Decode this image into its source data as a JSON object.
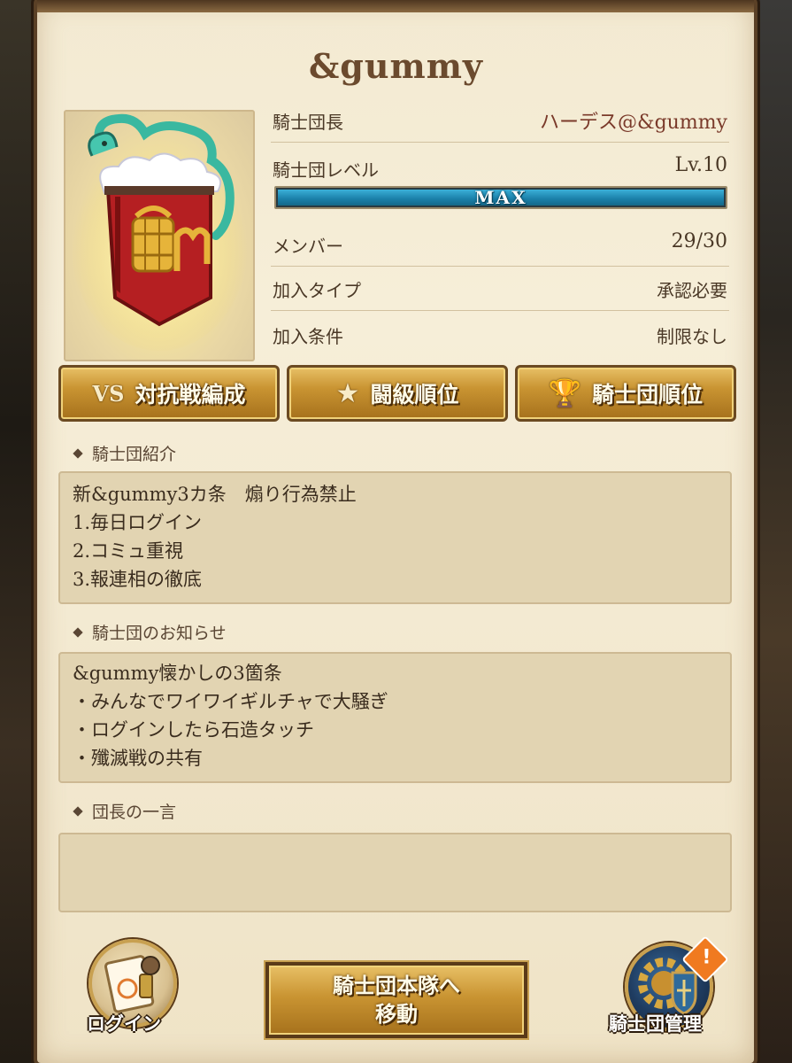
{
  "guild": {
    "name": "&gummy"
  },
  "info": [
    {
      "label": "騎士団長",
      "value": "ハーデス@&gummy"
    },
    {
      "label": "騎士団レベル",
      "value": "Lv.10"
    },
    {
      "label": "メンバー",
      "value": "29/30"
    },
    {
      "label": "加入タイプ",
      "value": "承認必要"
    },
    {
      "label": "加入条件",
      "value": "制限なし"
    }
  ],
  "level_bar": {
    "text": "MAX",
    "fill": 1.0,
    "color": "#1a8fc0"
  },
  "tabs": [
    {
      "label": "対抗戦編成",
      "icon": "vs-icon"
    },
    {
      "label": "闘級順位",
      "icon": "medal-icon"
    },
    {
      "label": "騎士団順位",
      "icon": "trophy-icon"
    }
  ],
  "sections": {
    "intro": {
      "heading": "騎士団紹介",
      "lines": [
        "新&gummy3カ条　煽り行為禁止",
        "1.毎日ログイン",
        "2.コミュ重視",
        "3.報連相の徹底"
      ]
    },
    "notice": {
      "heading": "騎士団のお知らせ",
      "lines": [
        "&gummy懐かしの3箇条",
        "・みんなでワイワイギルチャで大騒ぎ",
        "・ログインしたら石造タッチ",
        "・殲滅戦の共有"
      ]
    },
    "leader_comment": {
      "heading": "団長の一言",
      "lines": []
    }
  },
  "bottom": {
    "login_label": "ログイン",
    "main_button_line1": "騎士団本隊へ",
    "main_button_line2": "移動",
    "manage_label": "騎士団管理",
    "alert_mark": "!"
  }
}
